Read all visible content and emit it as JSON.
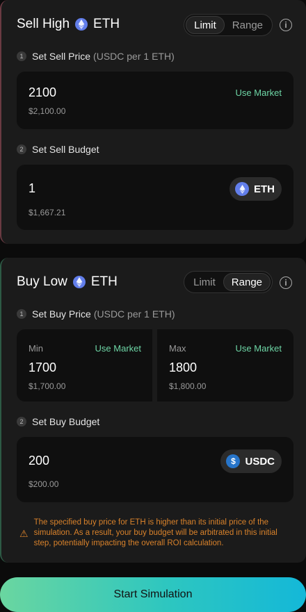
{
  "sell": {
    "title": "Sell High",
    "token": "ETH",
    "mode_options": [
      "Limit",
      "Range"
    ],
    "active_mode": "Limit",
    "info_icon": "info-icon",
    "price_step": {
      "num": "1",
      "label": "Set Sell Price",
      "sub": "(USDC per 1 ETH)"
    },
    "price": {
      "value": "2100",
      "usd": "$2,100.00",
      "market_label": "Use Market"
    },
    "budget_step": {
      "num": "2",
      "label": "Set Sell Budget"
    },
    "budget": {
      "value": "1",
      "usd": "$1,667.21",
      "token": "ETH"
    }
  },
  "buy": {
    "title": "Buy Low",
    "token": "ETH",
    "mode_options": [
      "Limit",
      "Range"
    ],
    "active_mode": "Range",
    "info_icon": "info-icon",
    "price_step": {
      "num": "1",
      "label": "Set Buy Price",
      "sub": "(USDC per 1 ETH)"
    },
    "min": {
      "label": "Min",
      "value": "1700",
      "usd": "$1,700.00",
      "market_label": "Use Market"
    },
    "max": {
      "label": "Max",
      "value": "1800",
      "usd": "$1,800.00",
      "market_label": "Use Market"
    },
    "budget_step": {
      "num": "2",
      "label": "Set Buy Budget"
    },
    "budget": {
      "value": "200",
      "usd": "$200.00",
      "token": "USDC"
    },
    "warning": "The specified buy price for ETH is higher than its initial price of the simulation. As a result, your buy budget will be arbitrated in this initial step, potentially impacting the overall ROI calculation."
  },
  "cta": {
    "label": "Start Simulation"
  },
  "colors": {
    "accent_green": "#6ed6a6",
    "warning": "#d9822b",
    "eth": "#627eea",
    "usdc": "#2775ca"
  }
}
